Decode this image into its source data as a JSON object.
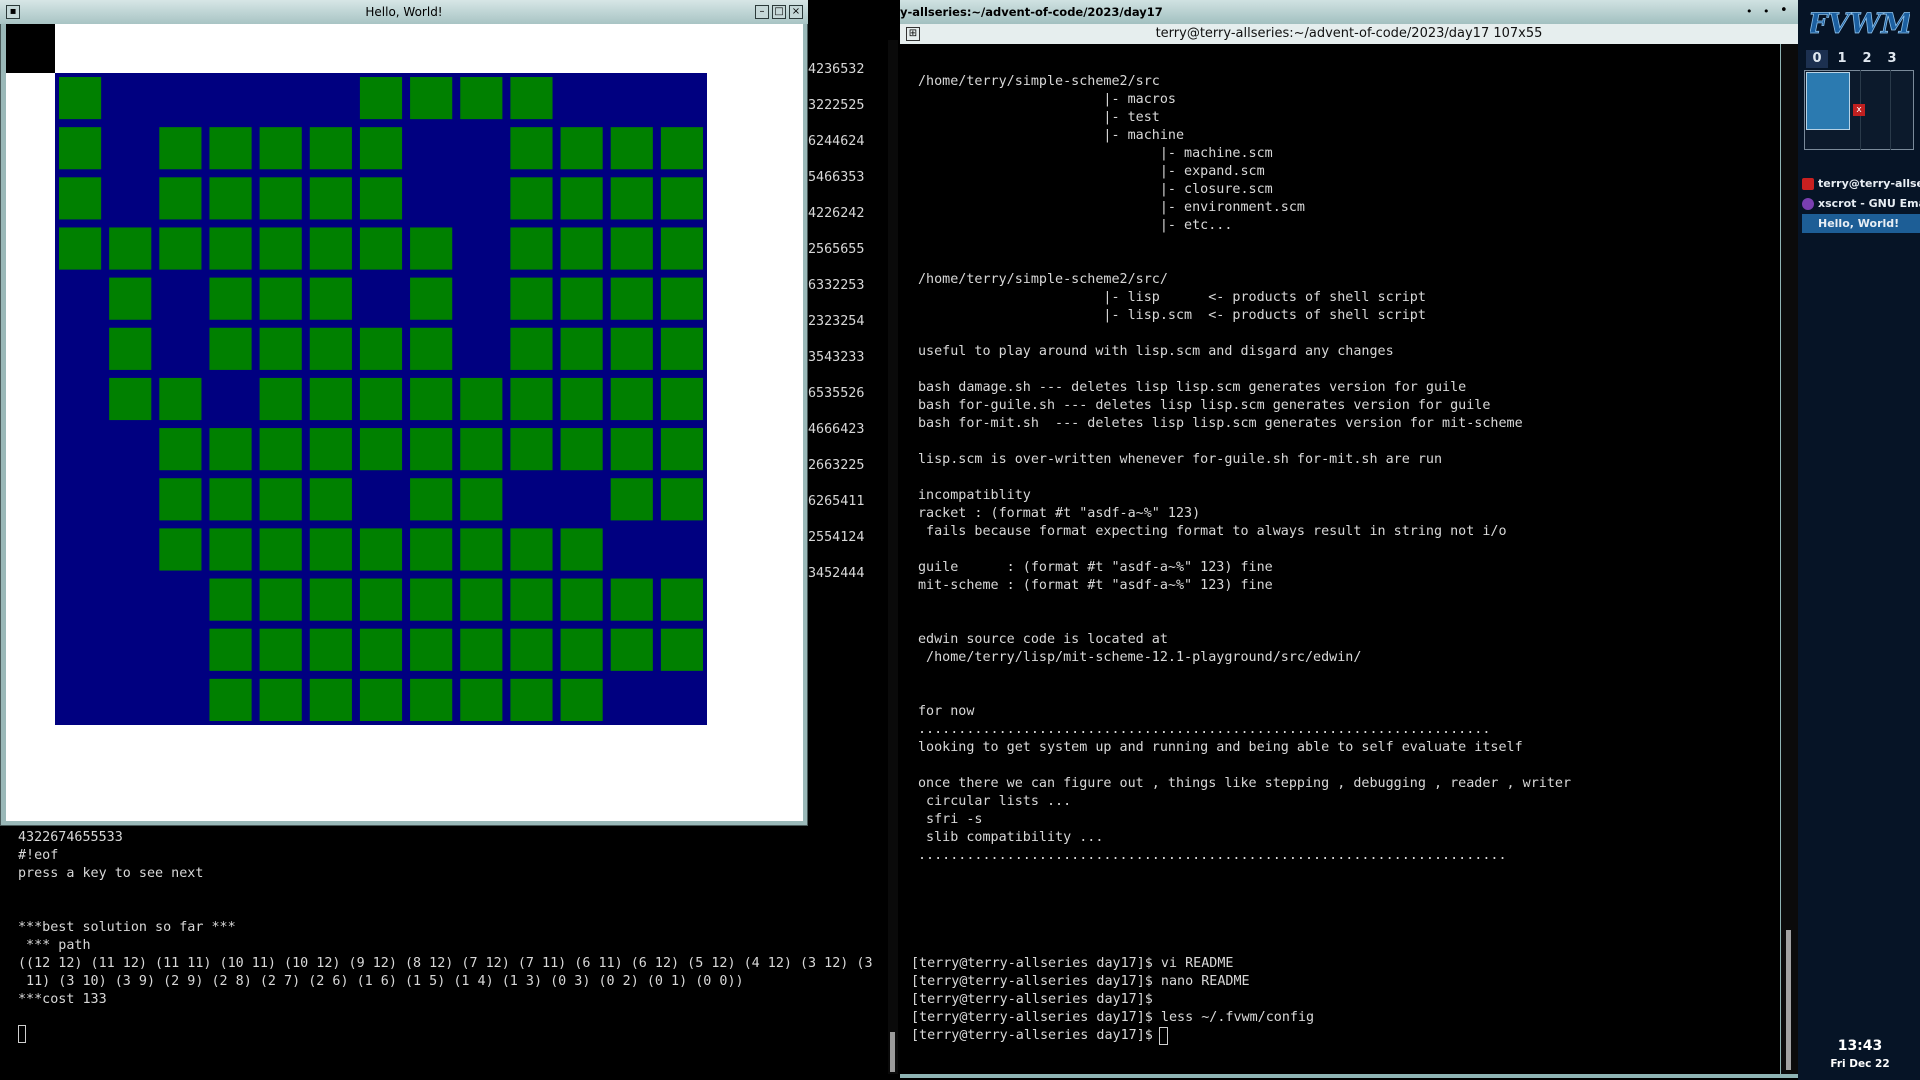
{
  "hello_window": {
    "title": "Hello, World!",
    "colors": {
      "background": "#000080",
      "cell_open": "#008000",
      "blank": "#ffffff"
    },
    "grid_rows": [
      "1.....1111...",
      "1.11111..1111",
      "1.11111..1111",
      "11111111.1111",
      ".1.111.1.1111",
      ".1.11111.1111",
      ".11.111111111",
      "..11111111111",
      "..1111.11..11",
      "..111111111..",
      "...1111111111",
      "...1111111111",
      "...11111111.."
    ]
  },
  "left_terminal": {
    "numbers": [
      "4236532",
      "3222525",
      "6244624",
      "5466353",
      "4226242",
      "2565655",
      "6332253",
      "2323254",
      "3543233",
      "6535526",
      "4666423",
      "2663225",
      "6265411",
      "2554124",
      "3452444"
    ],
    "output_lines": [
      "4322674655533",
      "#!eof",
      "press a key to see next",
      "",
      "",
      "***best solution so far ***",
      " *** path",
      "((12 12) (11 12) (11 11) (10 11) (10 12) (9 12) (8 12) (7 12) (7 11) (6 11) (6 12) (5 12) (4 12) (3 12) (3",
      " 11) (3 10) (3 9) (2 9) (2 8) (2 7) (2 6) (1 6) (1 5) (1 4) (1 3) (0 3) (0 2) (0 1) (0 0))",
      "***cost 133"
    ]
  },
  "right_terminal": {
    "window_title": "y-allseries:~/advent-of-code/2023/day17",
    "tab_title": "terry@terry-allseries:~/advent-of-code/2023/day17 107x55",
    "readme_text": "/home/terry/simple-scheme2/src\n                       |- macros\n                       |- test\n                       |- machine\n                              |- machine.scm\n                              |- expand.scm\n                              |- closure.scm\n                              |- environment.scm\n                              |- etc...\n\n\n/home/terry/simple-scheme2/src/\n                       |- lisp      <- products of shell script\n                       |- lisp.scm  <- products of shell script\n\nuseful to play around with lisp.scm and disgard any changes\n\nbash damage.sh --- deletes lisp lisp.scm generates version for guile\nbash for-guile.sh --- deletes lisp lisp.scm generates version for guile\nbash for-mit.sh  --- deletes lisp lisp.scm generates version for mit-scheme\n\nlisp.scm is over-written whenever for-guile.sh for-mit.sh are run\n\nincompatiblity\nracket : (format #t \"asdf-a~%\" 123)\n fails because format expecting format to always result in string not i/o\n\nguile      : (format #t \"asdf-a~%\" 123) fine\nmit-scheme : (format #t \"asdf-a~%\" 123) fine\n\n\nedwin source code is located at\n /home/terry/lisp/mit-scheme-12.1-playground/src/edwin/\n\n\nfor now\n.......................................................................\nlooking to get system up and running and being able to self evaluate itself\n\nonce there we can figure out , things like stepping , debugging , reader , writer\n circular lists ...\n sfri -s\n slib compatibility ...\n.........................................................................",
    "prompt_lines": [
      "[terry@terry-allseries day17]$ vi README",
      "[terry@terry-allseries day17]$ nano README",
      "[terry@terry-allseries day17]$",
      "[terry@terry-allseries day17]$ less ~/.fvwm/config",
      "[terry@terry-allseries day17]$ "
    ]
  },
  "panel": {
    "logo_text": "FVWM",
    "desks": [
      "0",
      "1",
      "2",
      "3"
    ],
    "pager_close": "x",
    "tasks": [
      {
        "label": "terry@terry-allser",
        "icon_color": "#c82020"
      },
      {
        "label": "xscrot - GNU Ema",
        "icon_color": "#7a3fb0"
      },
      {
        "label": "Hello, World!",
        "icon_color": ""
      }
    ],
    "clock": "13:43",
    "date": "Fri Dec 22"
  }
}
